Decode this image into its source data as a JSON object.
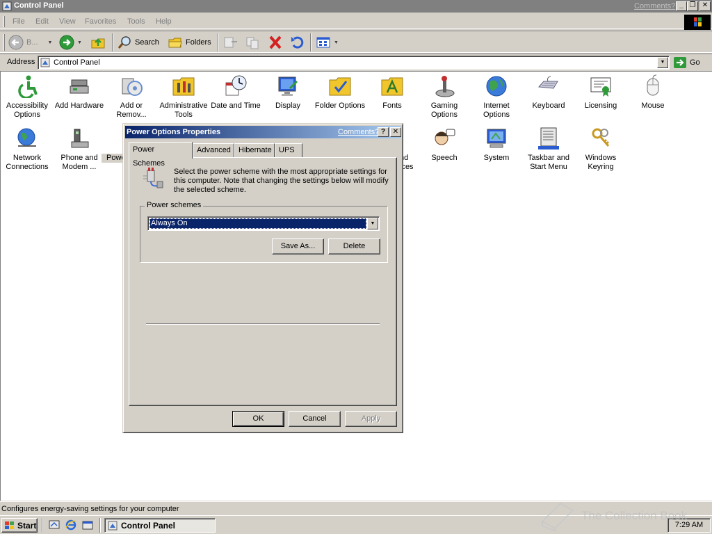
{
  "window": {
    "title": "Control Panel",
    "comments_link": "Comments?"
  },
  "menu": [
    "File",
    "Edit",
    "View",
    "Favorites",
    "Tools",
    "Help"
  ],
  "toolbar": {
    "back_label": "B...",
    "search_label": "Search",
    "folders_label": "Folders"
  },
  "address": {
    "label": "Address",
    "value": "Control Panel",
    "go_label": "Go"
  },
  "control_panel_items": [
    {
      "label": "Accessibility Options",
      "icon": "accessibility-icon"
    },
    {
      "label": "Add Hardware",
      "icon": "add-hardware-icon"
    },
    {
      "label": "Add or Remov...",
      "icon": "add-remove-programs-icon"
    },
    {
      "label": "Administrative Tools",
      "icon": "administrative-tools-icon"
    },
    {
      "label": "Date and Time",
      "icon": "date-time-icon"
    },
    {
      "label": "Display",
      "icon": "display-icon"
    },
    {
      "label": "Folder Options",
      "icon": "folder-options-icon"
    },
    {
      "label": "Fonts",
      "icon": "fonts-icon"
    },
    {
      "label": "Gaming Options",
      "icon": "gaming-options-icon"
    },
    {
      "label": "Internet Options",
      "icon": "internet-options-icon"
    },
    {
      "label": "Keyboard",
      "icon": "keyboard-icon"
    },
    {
      "label": "Licensing",
      "icon": "licensing-icon"
    },
    {
      "label": "Mouse",
      "icon": "mouse-icon"
    },
    {
      "label": "Network Connections",
      "icon": "network-connections-icon"
    },
    {
      "label": "Phone and Modem ...",
      "icon": "phone-modem-icon"
    },
    {
      "label": "Powe",
      "icon": "power-options-icon"
    },
    {
      "label": "nd\nices",
      "icon": "sounds-devices-icon"
    },
    {
      "label": "Speech",
      "icon": "speech-icon"
    },
    {
      "label": "System",
      "icon": "system-icon"
    },
    {
      "label": "Taskbar and Start Menu",
      "icon": "taskbar-start-menu-icon"
    },
    {
      "label": "Windows Keyring",
      "icon": "windows-keyring-icon"
    }
  ],
  "status_text": "Configures energy-saving settings for your computer",
  "taskbar": {
    "start_label": "Start",
    "task_label": "Control Panel",
    "clock": "7:29 AM"
  },
  "watermark": "The Collection Book",
  "dialog": {
    "title": "Power Options Properties",
    "comments_link": "Comments?",
    "tabs": [
      "Power Schemes",
      "Advanced",
      "Hibernate",
      "UPS"
    ],
    "intro": "Select the power scheme with the most appropriate settings for this computer. Note that changing the settings below will modify the selected scheme.",
    "group_label": "Power schemes",
    "selected_scheme": "Always On",
    "save_as_label": "Save As...",
    "delete_label": "Delete",
    "ok_label": "OK",
    "cancel_label": "Cancel",
    "apply_label": "Apply"
  }
}
